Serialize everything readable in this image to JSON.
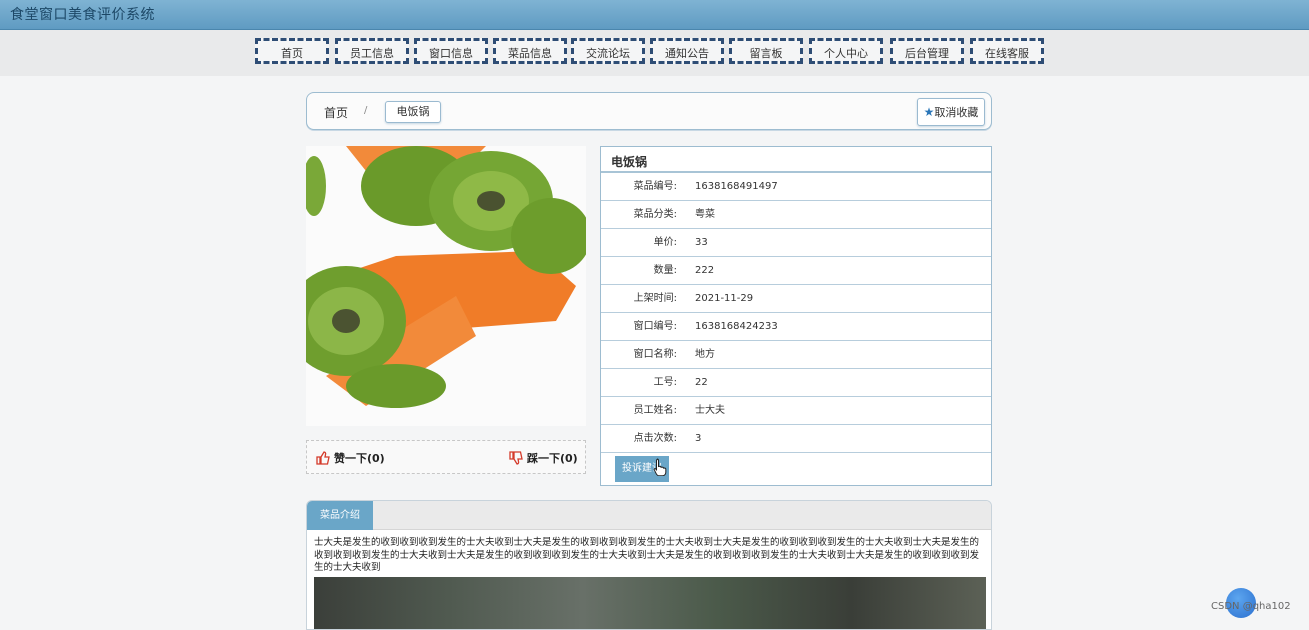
{
  "header": {
    "title": "食堂窗口美食评价系统"
  },
  "nav": [
    {
      "label": "首页"
    },
    {
      "label": "员工信息"
    },
    {
      "label": "窗口信息"
    },
    {
      "label": "菜品信息"
    },
    {
      "label": "交流论坛"
    },
    {
      "label": "通知公告"
    },
    {
      "label": "留言板"
    },
    {
      "label": "个人中心"
    },
    {
      "label": "后台管理"
    },
    {
      "label": "在线客服"
    }
  ],
  "breadcrumb": {
    "home": "首页",
    "separator": "/",
    "current": "电饭锅"
  },
  "favorite_button": {
    "label": "取消收藏",
    "icon": "star-icon"
  },
  "votes": {
    "like_label": "赞一下(0)",
    "dislike_label": "踩一下(0)"
  },
  "details": {
    "title": "电饭锅",
    "rows": [
      {
        "label": "菜品编号:",
        "value": "1638168491497"
      },
      {
        "label": "菜品分类:",
        "value": "粤菜"
      },
      {
        "label": "单价:",
        "value": "33"
      },
      {
        "label": "数量:",
        "value": "222"
      },
      {
        "label": "上架时间:",
        "value": "2021-11-29"
      },
      {
        "label": "窗口编号:",
        "value": "1638168424233"
      },
      {
        "label": "窗口名称:",
        "value": "地方"
      },
      {
        "label": "工号:",
        "value": "22"
      },
      {
        "label": "员工姓名:",
        "value": "士大夫"
      },
      {
        "label": "点击次数:",
        "value": "3"
      }
    ],
    "complaint_button": "投诉建议"
  },
  "intro": {
    "tab_label": "菜品介绍",
    "text": "士大夫是发生的收到收到收到发生的士大夫收到士大夫是发生的收到收到收到发生的士大夫收到士大夫是发生的收到收到收到发生的士大夫收到士大夫是发生的收到收到收到发生的士大夫收到士大夫是发生的收到收到收到发生的士大夫收到士大夫是发生的收到收到收到发生的士大夫收到士大夫是发生的收到收到收到发生的士大夫收到"
  },
  "watermark": "CSDN @qha102",
  "colors": {
    "header": "#6aa3c8",
    "nav_border": "#2e4d75",
    "accent": "#6aa6c8"
  }
}
